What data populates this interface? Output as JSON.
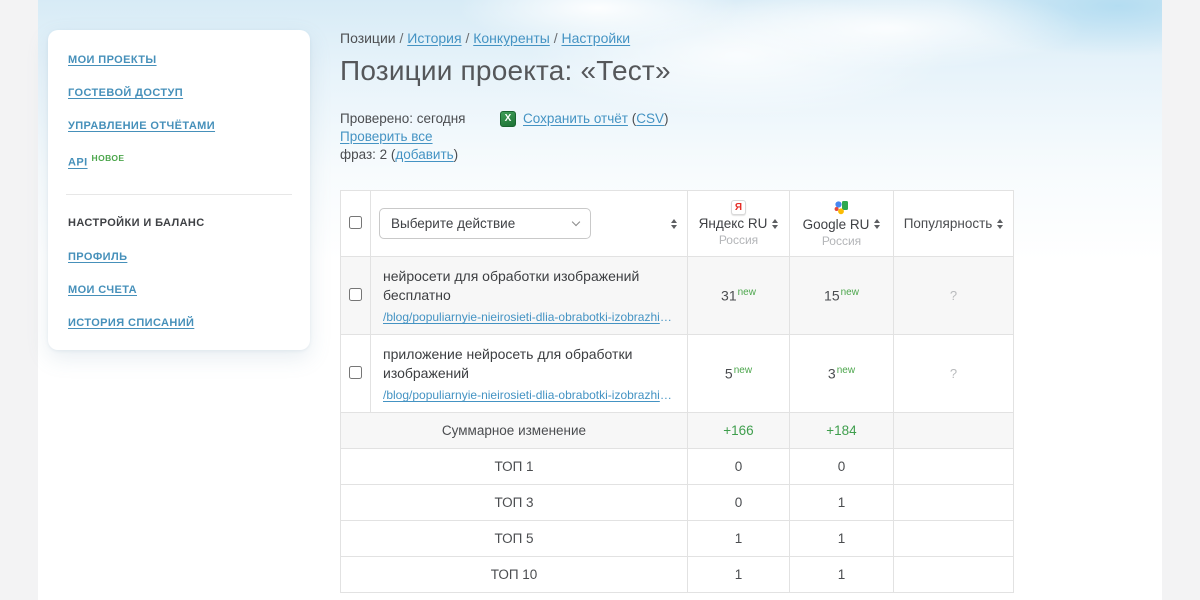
{
  "colors": {
    "link_blue": "#4493c3",
    "green": "#4ca64c",
    "row_stripe": "#f7f7f7",
    "sky": "#d7ebf6"
  },
  "sidebar": {
    "links_top": [
      {
        "label": "МОИ ПРОЕКТЫ"
      },
      {
        "label": "ГОСТЕВОЙ ДОСТУП"
      },
      {
        "label": "УПРАВЛЕНИЕ ОТЧЁТАМИ"
      },
      {
        "label": "API",
        "badge": "НОВОЕ"
      }
    ],
    "section_header": "НАСТРОЙКИ И БАЛАНС",
    "links_bottom": [
      {
        "label": "ПРОФИЛЬ"
      },
      {
        "label": "МОИ СЧЕТА"
      },
      {
        "label": "ИСТОРИЯ СПИСАНИЙ"
      }
    ]
  },
  "breadcrumb": {
    "current": "Позиции",
    "separator": "/",
    "links": [
      {
        "label": "История"
      },
      {
        "label": "Конкуренты"
      },
      {
        "label": "Настройки"
      }
    ]
  },
  "header": {
    "title": "Позиции проекта: «Тест»"
  },
  "meta": {
    "checked": "Проверено: сегодня",
    "check_all": "Проверить все",
    "phrases_prefix": "фраз: 2 (",
    "add_link": "добавить",
    "phrases_suffix": ")",
    "xls_icon_letter": "X",
    "save_report": "Сохранить отчёт",
    "csv_prefix": "(",
    "csv_link": "CSV",
    "csv_suffix": ")"
  },
  "table": {
    "action_placeholder": "Выберите действие",
    "columns": {
      "yandex": {
        "name": "Яндекс RU",
        "region": "Россия",
        "icon_letter": "Я"
      },
      "google": {
        "name": "Google RU",
        "region": "Россия"
      },
      "popularity": {
        "name": "Популярность"
      }
    },
    "rows": [
      {
        "phrase": "нейросети для обработки изображений бесплатно",
        "url": "/blog/populiarnyie-nieirosieti-dlia-obrabotki-izobrazhieni...",
        "yandex": "31",
        "yandex_badge": "new",
        "google": "15",
        "google_badge": "new",
        "popularity": "?"
      },
      {
        "phrase": "приложение нейросеть для обработки изображений",
        "url": "/blog/populiarnyie-nieirosieti-dlia-obrabotki-izobrazhieni...",
        "yandex": "5",
        "yandex_badge": "new",
        "google": "3",
        "google_badge": "new",
        "popularity": "?"
      }
    ],
    "summary": [
      {
        "label": "Суммарное изменение",
        "yandex": "+166",
        "google": "+184",
        "popularity": ""
      },
      {
        "label": "ТОП 1",
        "yandex": "0",
        "google": "0",
        "popularity": ""
      },
      {
        "label": "ТОП 3",
        "yandex": "0",
        "google": "1",
        "popularity": ""
      },
      {
        "label": "ТОП 5",
        "yandex": "1",
        "google": "1",
        "popularity": ""
      },
      {
        "label": "ТОП 10",
        "yandex": "1",
        "google": "1",
        "popularity": ""
      }
    ]
  }
}
